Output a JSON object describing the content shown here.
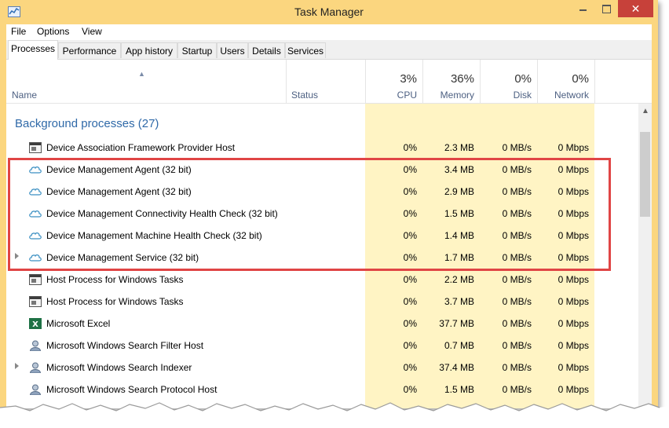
{
  "window": {
    "title": "Task Manager",
    "close_glyph": "✕"
  },
  "menu": [
    "File",
    "Options",
    "View"
  ],
  "tabs": [
    "Processes",
    "Performance",
    "App history",
    "Startup",
    "Users",
    "Details",
    "Services"
  ],
  "columns": {
    "name": "Name",
    "status": "Status",
    "cpu": {
      "pct": "3%",
      "label": "CPU"
    },
    "memory": {
      "pct": "36%",
      "label": "Memory"
    },
    "disk": {
      "pct": "0%",
      "label": "Disk"
    },
    "network": {
      "pct": "0%",
      "label": "Network"
    }
  },
  "group": {
    "title": "Background processes (27)"
  },
  "processes": [
    {
      "name": "Device Association Framework Provider Host",
      "icon": "service-window-icon",
      "expandable": false,
      "cpu": "0%",
      "memory": "2.3 MB",
      "disk": "0 MB/s",
      "network": "0 Mbps"
    },
    {
      "name": "Device Management Agent (32 bit)",
      "icon": "cloud-icon",
      "expandable": false,
      "cpu": "0%",
      "memory": "3.4 MB",
      "disk": "0 MB/s",
      "network": "0 Mbps"
    },
    {
      "name": "Device Management Agent (32 bit)",
      "icon": "cloud-icon",
      "expandable": false,
      "cpu": "0%",
      "memory": "2.9 MB",
      "disk": "0 MB/s",
      "network": "0 Mbps"
    },
    {
      "name": "Device Management Connectivity Health Check (32 bit)",
      "icon": "cloud-icon",
      "expandable": false,
      "cpu": "0%",
      "memory": "1.5 MB",
      "disk": "0 MB/s",
      "network": "0 Mbps"
    },
    {
      "name": "Device Management Machine Health Check (32 bit)",
      "icon": "cloud-icon",
      "expandable": false,
      "cpu": "0%",
      "memory": "1.4 MB",
      "disk": "0 MB/s",
      "network": "0 Mbps"
    },
    {
      "name": "Device Management Service (32 bit)",
      "icon": "cloud-icon",
      "expandable": true,
      "cpu": "0%",
      "memory": "1.7 MB",
      "disk": "0 MB/s",
      "network": "0 Mbps"
    },
    {
      "name": "Host Process for Windows Tasks",
      "icon": "service-window-icon",
      "expandable": false,
      "cpu": "0%",
      "memory": "2.2 MB",
      "disk": "0 MB/s",
      "network": "0 Mbps"
    },
    {
      "name": "Host Process for Windows Tasks",
      "icon": "service-window-icon",
      "expandable": false,
      "cpu": "0%",
      "memory": "3.7 MB",
      "disk": "0 MB/s",
      "network": "0 Mbps"
    },
    {
      "name": "Microsoft Excel",
      "icon": "excel-icon",
      "expandable": false,
      "cpu": "0%",
      "memory": "37.7 MB",
      "disk": "0 MB/s",
      "network": "0 Mbps"
    },
    {
      "name": "Microsoft Windows Search Filter Host",
      "icon": "search-user-icon",
      "expandable": false,
      "cpu": "0%",
      "memory": "0.7 MB",
      "disk": "0 MB/s",
      "network": "0 Mbps"
    },
    {
      "name": "Microsoft Windows Search Indexer",
      "icon": "search-user-icon",
      "expandable": true,
      "cpu": "0%",
      "memory": "37.4 MB",
      "disk": "0 MB/s",
      "network": "0 Mbps"
    },
    {
      "name": "Microsoft Windows Search Protocol Host",
      "icon": "search-user-icon",
      "expandable": false,
      "cpu": "0%",
      "memory": "1.5 MB",
      "disk": "0 MB/s",
      "network": "0 Mbps"
    }
  ],
  "colors": {
    "highlight": "#e04545",
    "metric_bg": "#fff4c4",
    "group_title": "#2f69a8",
    "window_frame": "#fbd67f"
  }
}
